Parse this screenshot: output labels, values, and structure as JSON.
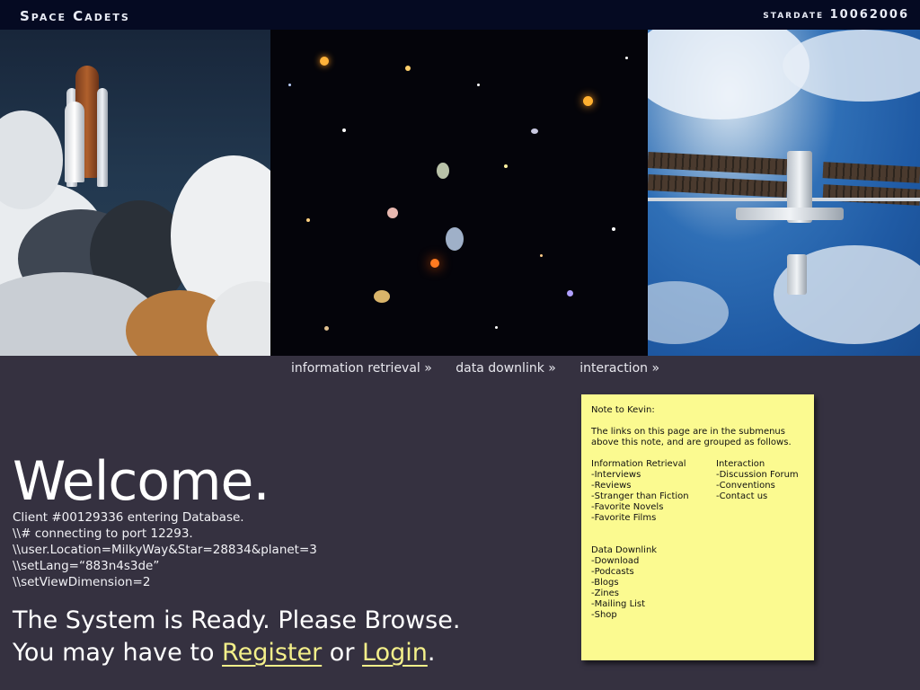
{
  "header": {
    "brand": "Space Cadets",
    "stardate": "stardate 10062006"
  },
  "photos": [
    {
      "name": "shuttle-launch-photo"
    },
    {
      "name": "deep-field-photo"
    },
    {
      "name": "space-station-photo"
    }
  ],
  "nav": {
    "items": [
      "information retrieval »",
      "data downlink »",
      "interaction »"
    ]
  },
  "welcome": {
    "title": "Welcome.",
    "log": [
      "Client #00129336 entering Database.",
      "\\\\# connecting to port 12293.",
      "\\\\user.Location=MilkyWay&Star=28834&planet=3",
      "\\\\setLang=“883n4s3de”",
      "\\\\setViewDimension=2"
    ],
    "ready_line1": "The System is Ready.  Please Browse.",
    "ready_prefix": "You may have to ",
    "register_label": "Register",
    "or_text": " or ",
    "login_label": "Login",
    "period": "."
  },
  "note": {
    "greeting": "Note to Kevin:",
    "intro": "The links on this page are in the submenus above this note, and are grouped as follows.",
    "group1_title": "Information Retrieval",
    "group1_items": [
      "-Interviews",
      "-Reviews",
      "-Stranger than Fiction",
      "-Favorite Novels",
      "-Favorite Films"
    ],
    "group2_title": "Interaction",
    "group2_items": [
      "-Discussion Forum",
      "-Conventions",
      "-Contact us"
    ],
    "group3_title": "Data Downlink",
    "group3_items": [
      "-Download",
      "-Podcasts",
      "-Blogs",
      "-Zines",
      "-Mailing List",
      "-Shop"
    ]
  },
  "colors": {
    "background": "#353140",
    "topbar": "#050a22",
    "note": "#fbfa90",
    "link": "#f3ef8a"
  }
}
